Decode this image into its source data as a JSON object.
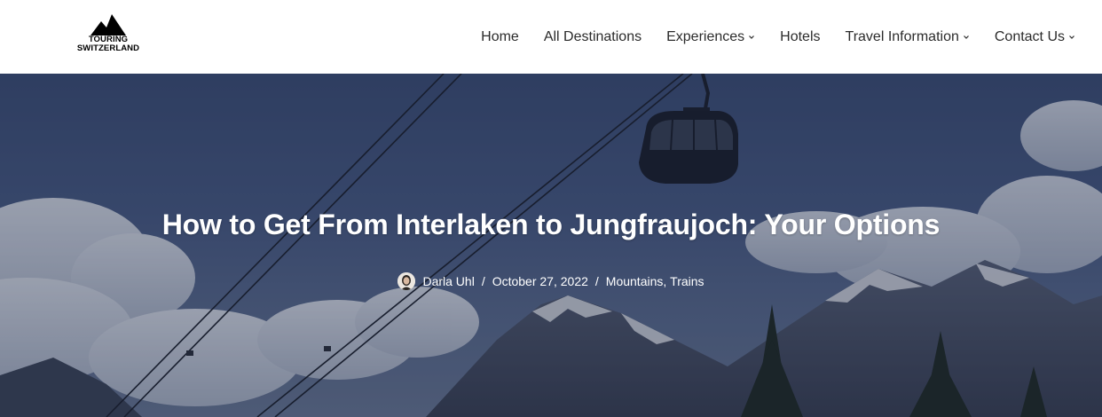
{
  "logo": {
    "line1": "TOURING",
    "line2": "SWITZERLAND"
  },
  "nav": [
    {
      "label": "Home",
      "has_dropdown": false
    },
    {
      "label": "All Destinations",
      "has_dropdown": false
    },
    {
      "label": "Experiences",
      "has_dropdown": true
    },
    {
      "label": "Hotels",
      "has_dropdown": false
    },
    {
      "label": "Travel Information",
      "has_dropdown": true
    },
    {
      "label": "Contact Us",
      "has_dropdown": true
    }
  ],
  "hero": {
    "title": "How to Get From Interlaken to Jungfraujoch: Your Options",
    "author": "Darla Uhl",
    "date": "October 27, 2022",
    "separator": "/",
    "categories": [
      "Mountains",
      "Trains"
    ],
    "category_delimiter": ","
  },
  "colors": {
    "header_bg": "#ffffff",
    "nav_text": "#2b2b2b",
    "hero_text": "#ffffff",
    "sky": "#4a5d86"
  },
  "icons": {
    "logo": "mountain-peaks-icon",
    "dropdown": "chevron-down-icon",
    "author": "avatar-photo"
  }
}
